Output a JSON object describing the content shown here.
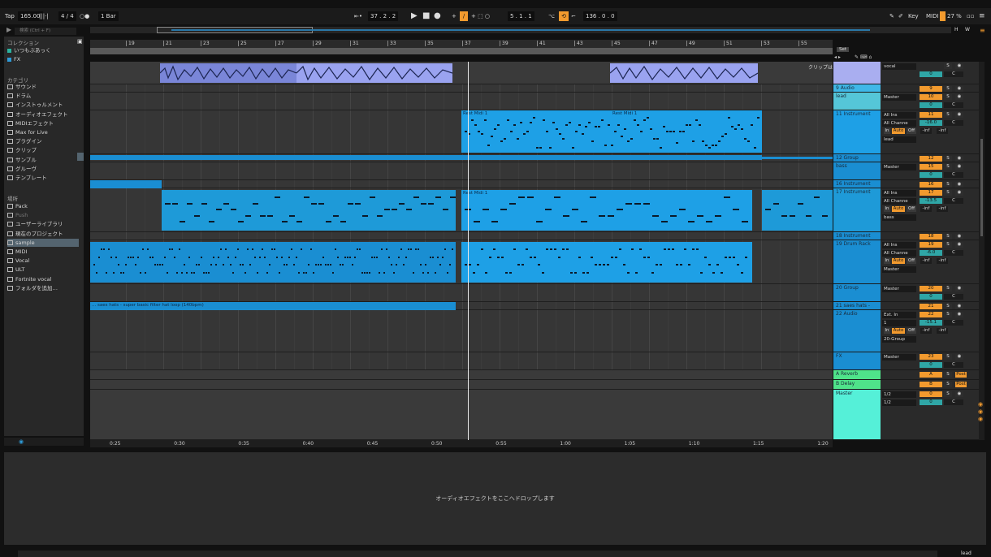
{
  "topbar": {
    "tap": "Tap",
    "tempo": "165.00",
    "signature": "4 / 4",
    "metronome": "○●",
    "quantize": "1 Bar",
    "position": "37 .  2 .  2",
    "loop_start": "5 .  1 .  1",
    "loop_length": "136 .  0 .  0",
    "key": "Key",
    "midi": "MIDI",
    "cpu": "27 %"
  },
  "browser": {
    "search_placeholder": "検索 (Ctrl + F)",
    "collections_title": "コレクション",
    "collections": [
      {
        "label": "いつもぶあっく",
        "color": "#2bb3a0"
      },
      {
        "label": "FX",
        "color": "#2e9bd8"
      }
    ],
    "categories_title": "カテゴリ",
    "categories": [
      "サウンド",
      "ドラム",
      "インストゥルメント",
      "オーディオエフェクト",
      "MIDIエフェクト",
      "Max for Live",
      "プラグイン",
      "クリップ",
      "サンプル",
      "グルーヴ",
      "テンプレート"
    ],
    "places_title": "場所",
    "places": [
      "Pack",
      "Push",
      "ユーザーライブラリ",
      "現在のプロジェクト",
      "sample",
      "MIDI",
      "Vocal",
      "ULT",
      "Fortnite vocal",
      "フォルダを追加…"
    ]
  },
  "ruler": {
    "bars": [
      "19",
      "21",
      "23",
      "25",
      "27",
      "29",
      "31",
      "33",
      "35",
      "37",
      "39",
      "41",
      "43",
      "45",
      "47",
      "49",
      "51",
      "53",
      "55"
    ],
    "times": [
      "0:25",
      "0:30",
      "0:35",
      "0:40",
      "0:45",
      "0:50",
      "0:55",
      "1:00",
      "1:05",
      "1:10",
      "1:15",
      "1:20"
    ]
  },
  "clips": {
    "rest1": "Rest Midi 1",
    "rest2": "Rest Midi 1",
    "rest3": "Rest Midi 1",
    "hats": "... saes hats - super basic filter hat loop (140bpm)",
    "ghost": "クリップは"
  },
  "tracks": [
    {
      "name": "",
      "num": "",
      "io": "vocal"
    },
    {
      "name": "9 Audio",
      "num": "9",
      "io": ""
    },
    {
      "name": "lead",
      "num": "10",
      "io": "Master"
    },
    {
      "name": "11 Instrument",
      "num": "11",
      "io": "All Ins",
      "io2": "All Channe",
      "vol": "-16.0",
      "out": "lead"
    },
    {
      "name": "12 Group",
      "num": "12",
      "io": ""
    },
    {
      "name": "bass",
      "num": "15",
      "io": "Master"
    },
    {
      "name": "16 Instrument",
      "num": "16",
      "io": ""
    },
    {
      "name": "17 Instrument",
      "num": "17",
      "io": "All Ins",
      "io2": "All Channe",
      "vol": "-13.5",
      "out": "bass"
    },
    {
      "name": "18 Instrument",
      "num": "18",
      "io": ""
    },
    {
      "name": "19 Drum Rack",
      "num": "19",
      "io": "All Ins",
      "io2": "All Channe",
      "vol": "-6.0",
      "out": "Master"
    },
    {
      "name": "20 Group",
      "num": "20",
      "io": "Master"
    },
    {
      "name": "21 saes hats -",
      "num": "21",
      "io": ""
    },
    {
      "name": "22 Audio",
      "num": "22",
      "io": "Ext. In",
      "io2": "1",
      "vol": "-15.1",
      "out": "20-Group"
    },
    {
      "name": "FX",
      "num": "23",
      "io": "Master"
    },
    {
      "name": "A Reverb",
      "num": "A",
      "io": "",
      "post": "Post"
    },
    {
      "name": "B Delay",
      "num": "B",
      "io": "",
      "post": "Post"
    },
    {
      "name": "Master",
      "num": "0",
      "io": "1/2",
      "io2": "1/2"
    }
  ],
  "mixer_labels": {
    "s": "S",
    "c": "C",
    "in": "In",
    "auto": "Auto",
    "off": "Off",
    "inf": "-inf",
    "zero": "0"
  },
  "device_hint": "オーディオエフェクトをここへドロップします",
  "set_label": "Set",
  "statusbar_right": "lead",
  "colors": {
    "accent": "#f29a2e",
    "clip_blue": "#1a9ae0",
    "audio_purple": "#a9aef0",
    "master_cyan": "#55f0d8",
    "reverb_green": "#4fe38a"
  }
}
